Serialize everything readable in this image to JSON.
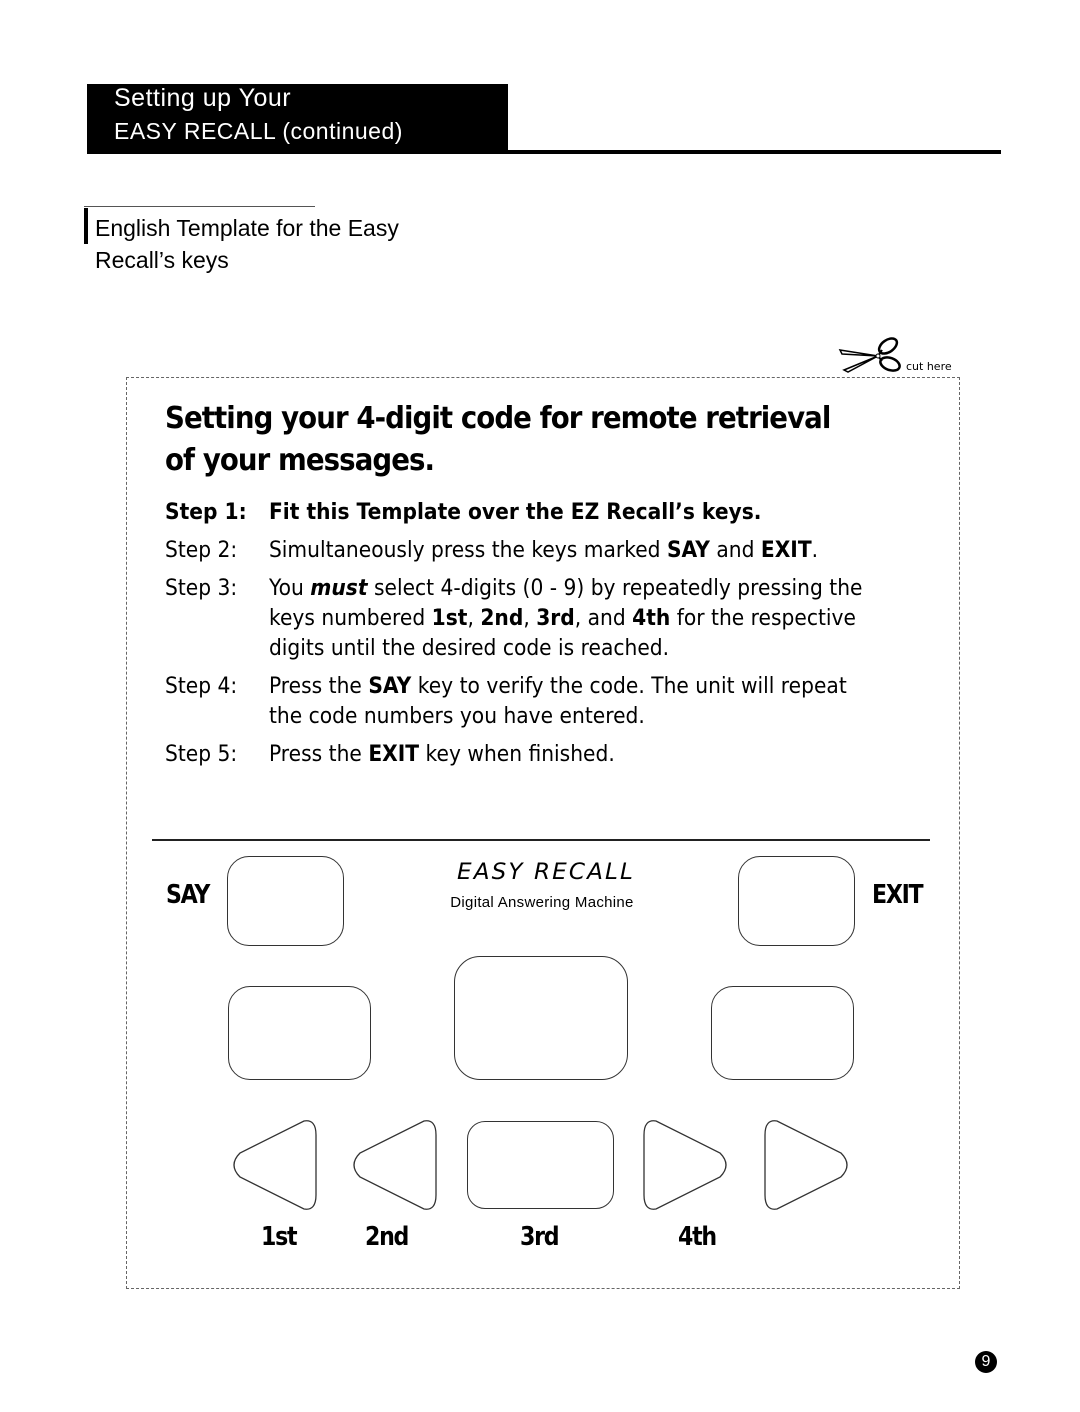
{
  "header": {
    "title_line1": "Setting up Your",
    "title_line2": "EASY RECALL (continued)"
  },
  "subheading": "English Template for the Easy Recall’s keys",
  "cut_here": {
    "icon": "scissors-icon",
    "label": "cut here"
  },
  "template": {
    "title": "Setting your 4-digit code for remote retrieval of your messages.",
    "steps": [
      {
        "num": "Step 1:",
        "parts": [
          {
            "t": "Fit this Template over the EZ Recall’s keys.",
            "b": true
          }
        ],
        "bold": true
      },
      {
        "num": "Step 2:",
        "parts": [
          {
            "t": "Simultaneously press the keys marked "
          },
          {
            "t": "SAY",
            "b": true
          },
          {
            "t": " and "
          },
          {
            "t": "EXIT",
            "b": true
          },
          {
            "t": "."
          }
        ]
      },
      {
        "num": "Step 3:",
        "parts": [
          {
            "t": "You "
          },
          {
            "t": "must",
            "b": true,
            "i": true
          },
          {
            "t": " select 4-digits (0 - 9) by repeatedly pressing the keys numbered "
          },
          {
            "t": "1st",
            "b": true
          },
          {
            "t": ", "
          },
          {
            "t": "2nd",
            "b": true
          },
          {
            "t": ", "
          },
          {
            "t": "3rd",
            "b": true
          },
          {
            "t": ", and "
          },
          {
            "t": "4th",
            "b": true
          },
          {
            "t": " for the respective digits until the desired code is reached."
          }
        ]
      },
      {
        "num": "Step 4:",
        "parts": [
          {
            "t": "Press the "
          },
          {
            "t": "SAY",
            "b": true
          },
          {
            "t": " key to verify the code. The unit will repeat the code numbers you have entered."
          }
        ]
      },
      {
        "num": "Step 5:",
        "parts": [
          {
            "t": "Press the "
          },
          {
            "t": "EXIT",
            "b": true
          },
          {
            "t": " key when finished."
          }
        ]
      }
    ],
    "keypad": {
      "say_label": "SAY",
      "exit_label": "EXIT",
      "brand": "EASY RECALL",
      "brand_sub": "Digital Answering Machine",
      "digit_labels": [
        "1st",
        "2nd",
        "3rd",
        "4th"
      ]
    }
  },
  "page_number": "9"
}
